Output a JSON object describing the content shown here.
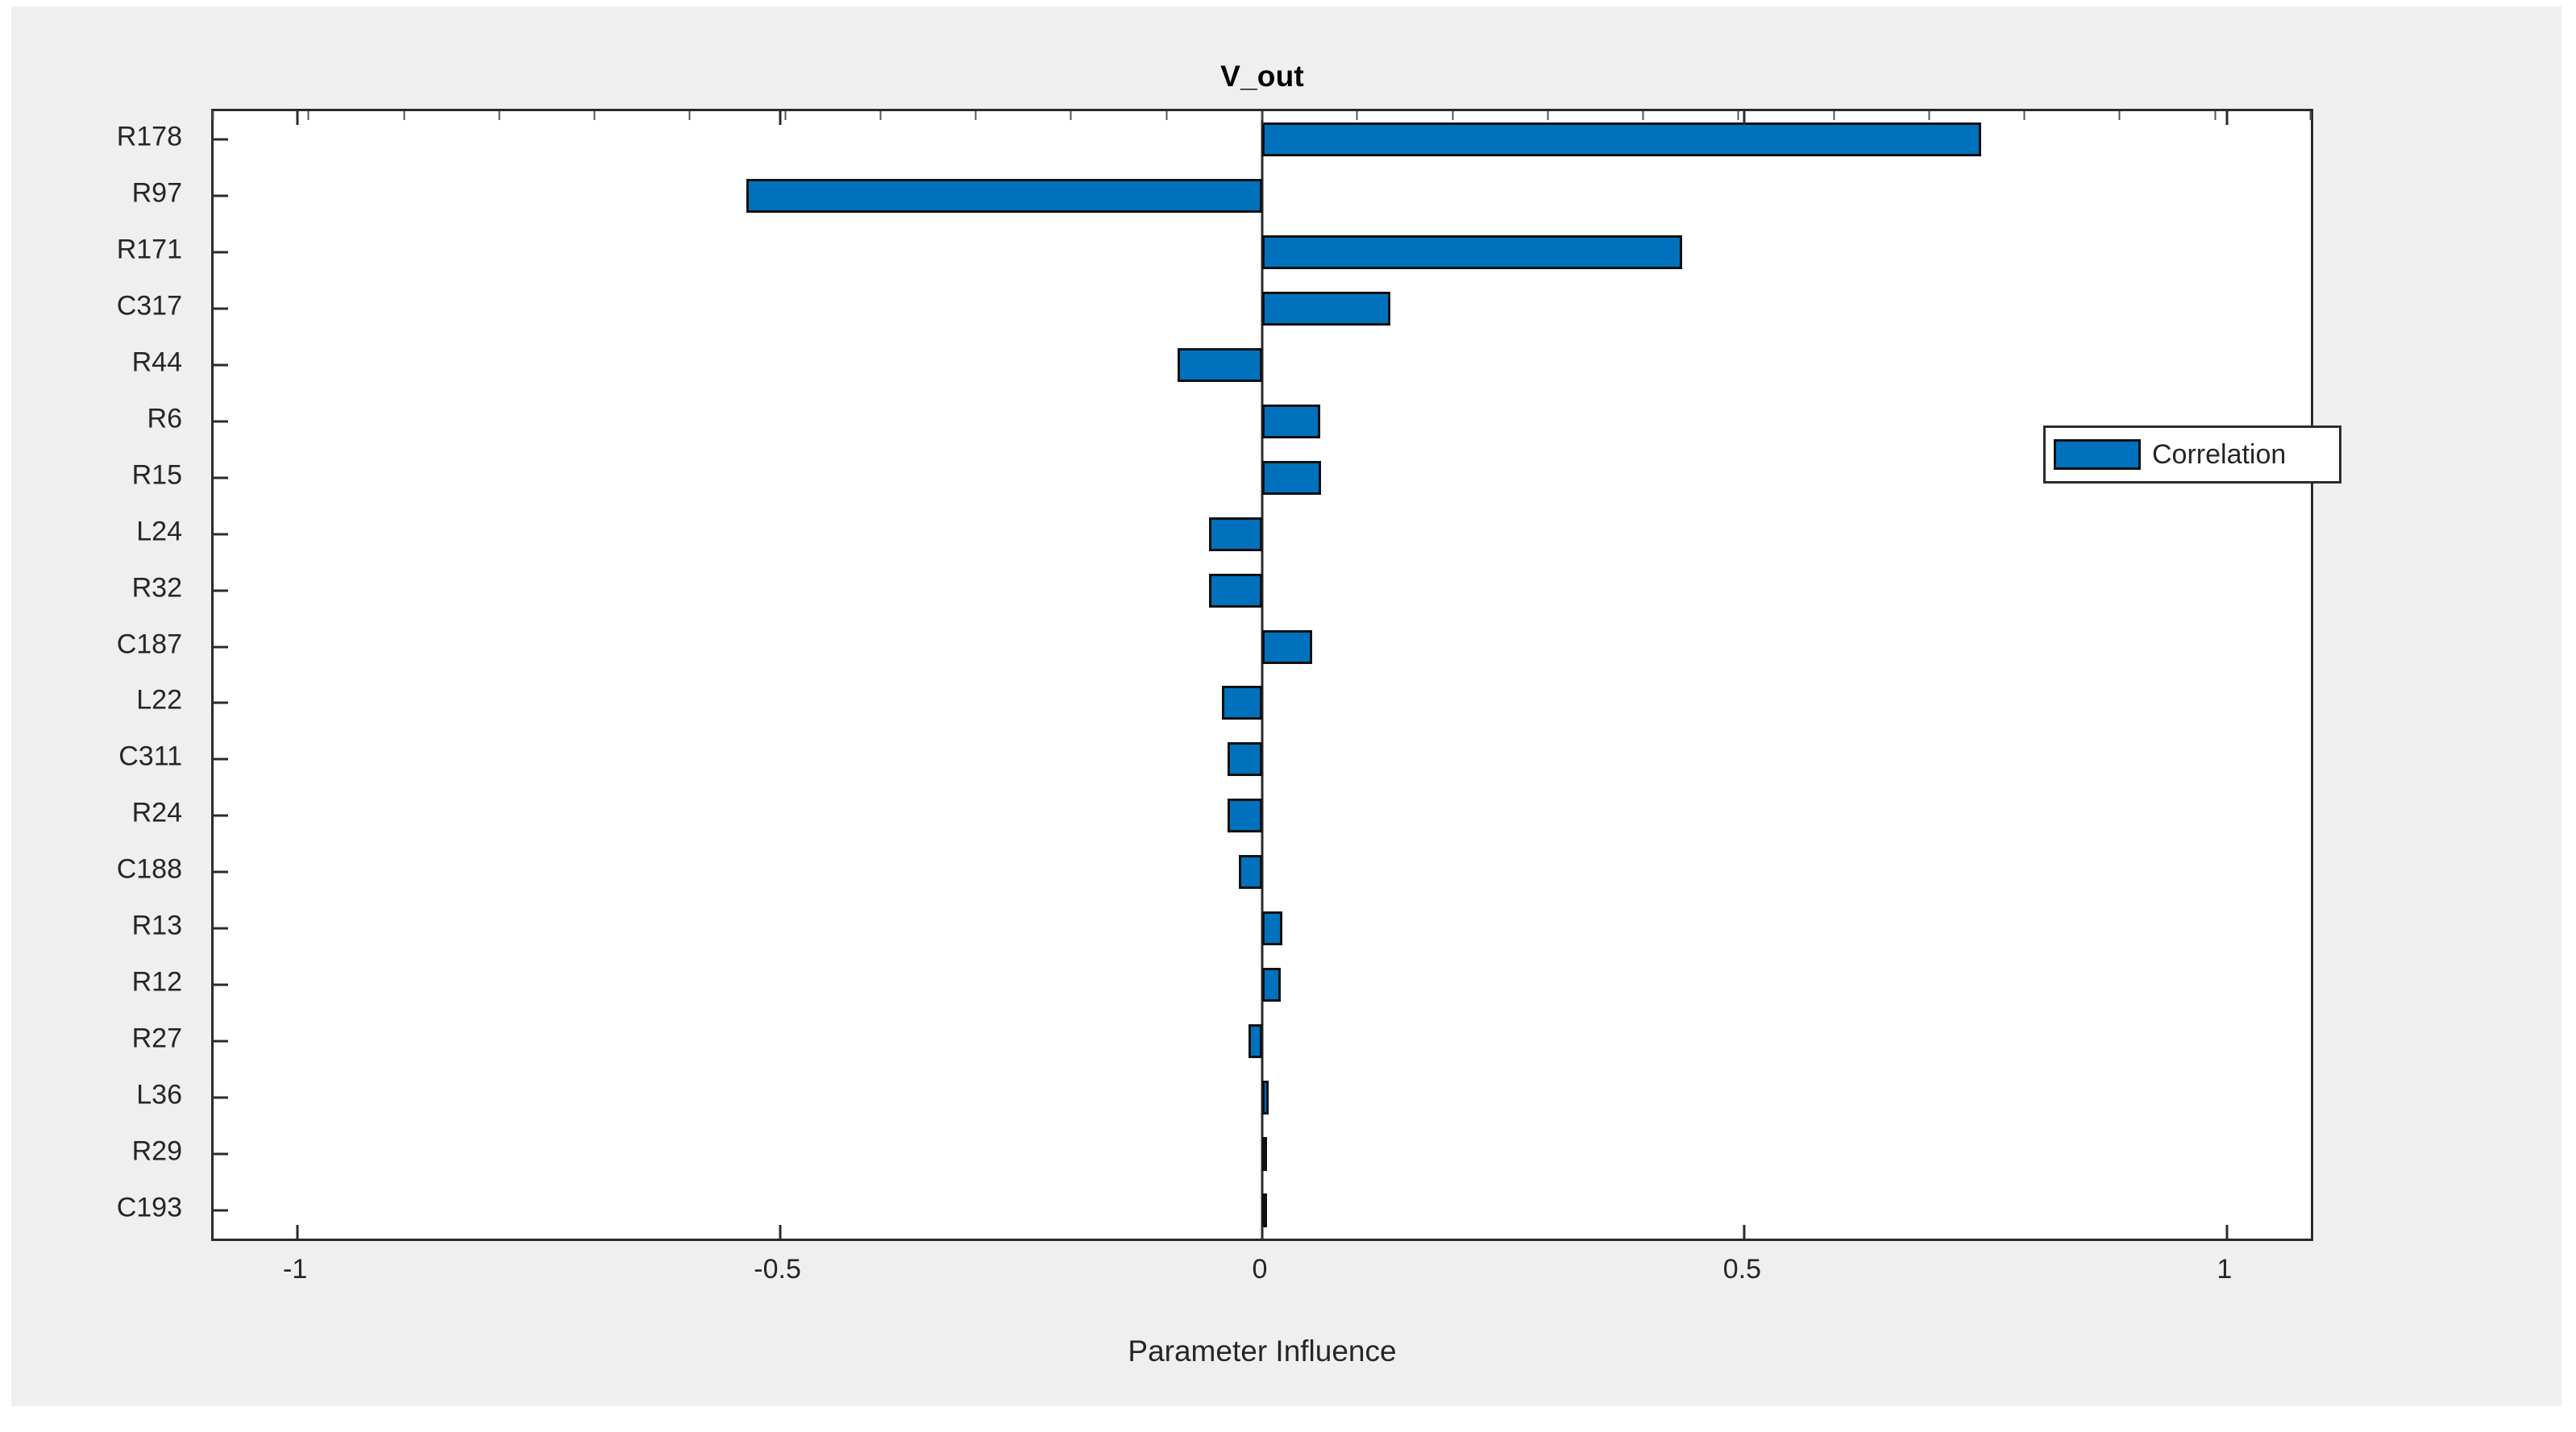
{
  "figure": {
    "title": "V_out",
    "background_color": "#efefef",
    "axes_background": "#ffffff"
  },
  "legend": {
    "entries": [
      {
        "label": "Correlation",
        "color": "#0072bd"
      }
    ],
    "position": "upper-right-inside"
  },
  "chart_data": {
    "type": "bar",
    "orientation": "horizontal",
    "title": "V_out",
    "xlabel": "Parameter Influence",
    "ylabel": "",
    "xlim": [
      -1.087,
      1.087
    ],
    "xticks": [
      -1,
      -0.5,
      0,
      0.5,
      1
    ],
    "xticklabels": [
      "-1",
      "-0.5",
      "0",
      "0.5",
      "1"
    ],
    "grid": false,
    "bar_color": "#0072bd",
    "bar_edge_color": "#101010",
    "legend_position": "upper right",
    "series": [
      {
        "name": "Correlation",
        "color": "#0072bd"
      }
    ],
    "categories": [
      "R178",
      "R97",
      "R171",
      "C317",
      "R44",
      "R6",
      "R15",
      "L24",
      "R32",
      "C187",
      "L22",
      "C311",
      "R24",
      "C188",
      "R13",
      "R12",
      "R27",
      "L36",
      "R29",
      "C193"
    ],
    "values": [
      0.745,
      -0.535,
      0.435,
      0.133,
      -0.088,
      0.06,
      0.061,
      -0.055,
      -0.055,
      0.052,
      -0.042,
      -0.036,
      -0.036,
      -0.024,
      0.021,
      0.019,
      -0.014,
      0.007,
      0.005,
      0.004
    ]
  }
}
